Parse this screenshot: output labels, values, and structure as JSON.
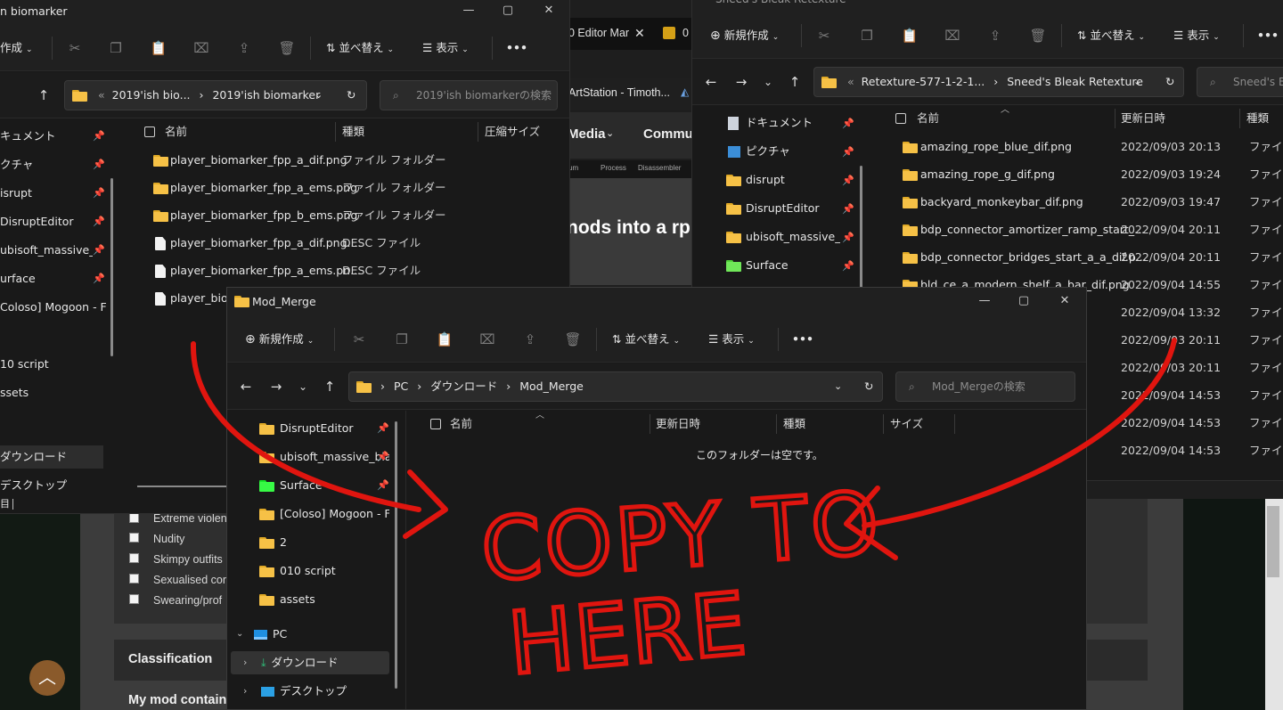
{
  "browser": {
    "tabs": [
      {
        "label": "0 Editor Mar"
      },
      {
        "label": "0"
      }
    ],
    "bookmark": "ArtStation - Timoth...",
    "nav": {
      "media": "Media",
      "community": "Commun"
    },
    "toolbar_crumbs": {
      "a": "um",
      "b": "Process",
      "c": "Disassembler"
    },
    "headline": "nods into a rp",
    "checkboxes": [
      "Extreme violen",
      "Nudity",
      "Skimpy outfits",
      "Sexualised cor",
      "Swearing/prof"
    ],
    "classification": "Classification",
    "mod_contains": "My mod contains"
  },
  "win_left": {
    "title": "n biomarker",
    "cmd": {
      "new": "作成",
      "sort": "並べ替え",
      "view": "表示",
      "more": "•••"
    },
    "address": {
      "prefix": "«",
      "crumb1": "2019'ish bio...",
      "crumb2": "2019'ish biomarker"
    },
    "search_placeholder": "2019'ish biomarkerの検索",
    "columns": {
      "name": "名前",
      "type": "種類",
      "size": "圧縮サイズ"
    },
    "sidebar": [
      "キュメント",
      "クチャ",
      "isrupt",
      "DisruptEditor",
      "ubisoft_massive_blac",
      "urface",
      "Coloso] Mogoon - Fun",
      "10 script",
      "ssets",
      "ダウンロード",
      "デスクトップ"
    ],
    "files": [
      {
        "name": "player_biomarker_fpp_a_dif.png",
        "type": "ファイル フォルダー",
        "kind": "folder"
      },
      {
        "name": "player_biomarker_fpp_a_ems.png",
        "type": "ファイル フォルダー",
        "kind": "folder"
      },
      {
        "name": "player_biomarker_fpp_b_ems.png",
        "type": "ファイル フォルダー",
        "kind": "folder"
      },
      {
        "name": "player_biomarker_fpp_a_dif.png....",
        "type": "DESC ファイル",
        "kind": "file"
      },
      {
        "name": "player_biomarker_fpp_a_ems.pn...",
        "type": "DESC ファイル",
        "kind": "file"
      },
      {
        "name": "player_biom",
        "type": "",
        "kind": "file"
      }
    ],
    "status": "目"
  },
  "win_right": {
    "title": "Sneed's Bleak Retexture",
    "cmd": {
      "new": "新規作成",
      "sort": "並べ替え",
      "view": "表示",
      "more": "•••"
    },
    "address": {
      "prefix": "«",
      "crumb1": "Retexture-577-1-2-1...",
      "crumb2": "Sneed's Bleak Retexture"
    },
    "search_placeholder": "Sneed's Bl",
    "columns": {
      "name": "名前",
      "date": "更新日時",
      "type": "種類"
    },
    "sidebar": [
      "ドキュメント",
      "ピクチャ",
      "disrupt",
      "DisruptEditor",
      "ubisoft_massive_blac",
      "Surface"
    ],
    "files": [
      {
        "name": "amazing_rope_blue_dif.png",
        "date": "2022/09/03 20:13",
        "type": "ファイル フ"
      },
      {
        "name": "amazing_rope_g_dif.png",
        "date": "2022/09/03 19:24",
        "type": "ファイル フ"
      },
      {
        "name": "backyard_monkeybar_dif.png",
        "date": "2022/09/03 19:47",
        "type": "ファイル フ"
      },
      {
        "name": "bdp_connector_amortizer_ramp_start_...",
        "date": "2022/09/04 20:11",
        "type": "ファイル フ"
      },
      {
        "name": "bdp_connector_bridges_start_a_a_dif.p...",
        "date": "2022/09/04 20:11",
        "type": "ファイル フ"
      },
      {
        "name": "bld_ce_a_modern_shelf_a_bar_dif.png",
        "date": "2022/09/04 14:55",
        "type": "ファイル フ"
      },
      {
        "name": "",
        "date": "2022/09/04 13:32",
        "type": "ファイル フ"
      },
      {
        "name": "",
        "date": "2022/09/03 20:11",
        "type": "ファイル フ"
      },
      {
        "name": "",
        "date": "2022/09/03 20:11",
        "type": "ファイル フ"
      },
      {
        "name": "",
        "date": "2022/09/04 14:53",
        "type": "ファイル フ"
      },
      {
        "name": "",
        "date": "2022/09/04 14:53",
        "type": "ファイル フ"
      },
      {
        "name": "",
        "date": "2022/09/04 14:53",
        "type": "ファイル フ"
      }
    ]
  },
  "win_main": {
    "title": "Mod_Merge",
    "cmd": {
      "new": "新規作成",
      "sort": "並べ替え",
      "view": "表示",
      "more": "•••"
    },
    "address": {
      "crumb1": "PC",
      "crumb2": "ダウンロード",
      "crumb3": "Mod_Merge"
    },
    "search_placeholder": "Mod_Mergeの検索",
    "columns": {
      "name": "名前",
      "date": "更新日時",
      "type": "種類",
      "size": "サイズ"
    },
    "empty_message": "このフォルダーは空です。",
    "sidebar": [
      {
        "label": "DisruptEditor",
        "pinned": true,
        "color": "yellow"
      },
      {
        "label": "ubisoft_massive_blac",
        "pinned": true,
        "color": "yellow"
      },
      {
        "label": "Surface",
        "pinned": true,
        "color": "green"
      },
      {
        "label": "[Coloso] Mogoon - Fun",
        "pinned": false,
        "color": "yellow"
      },
      {
        "label": "2",
        "pinned": false,
        "color": "yellow"
      },
      {
        "label": "010 script",
        "pinned": false,
        "color": "yellow"
      },
      {
        "label": "assets",
        "pinned": false,
        "color": "yellow"
      }
    ],
    "tree": {
      "pc": "PC",
      "downloads": "ダウンロード",
      "desktop": "デスクトップ"
    }
  },
  "annotation": {
    "line1": "COPY TO",
    "line2": "HERE",
    "color": "#e0150f"
  },
  "colors": {
    "accent_folder": "#f6c146",
    "scroll_top": "#8a5a2b"
  }
}
